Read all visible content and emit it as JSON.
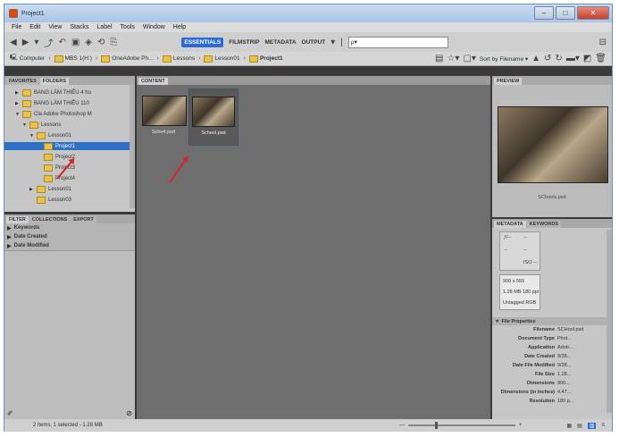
{
  "window": {
    "title": "Project1",
    "min": "–",
    "max": "□",
    "close": "✕"
  },
  "menu": [
    "File",
    "Edit",
    "View",
    "Stacks",
    "Label",
    "Tools",
    "Window",
    "Help"
  ],
  "toolbar": {
    "workspaces": [
      "ESSENTIALS",
      "FILMSTRIP",
      "METADATA",
      "OUTPUT"
    ],
    "active_workspace": "ESSENTIALS",
    "search_placeholder": "ρ▾"
  },
  "path": {
    "crumbs": [
      "Computer",
      "MBS 1(H:)",
      "OneAdobe Ph...",
      "Lessons",
      "Lesson01",
      "Project1"
    ],
    "sort_label": "Sort by Filename ▾"
  },
  "left_panel": {
    "tabs": [
      "FAVORITES",
      "FOLDERS"
    ],
    "tree": [
      {
        "label": "BANG LÄM THIÊU 4 ho",
        "depth": 0,
        "twisty": "▶"
      },
      {
        "label": "BANG LÄM THIÊU 110",
        "depth": 0,
        "twisty": "▶"
      },
      {
        "label": "Cla Adobe Photoshop M",
        "depth": 0,
        "twisty": "▼"
      },
      {
        "label": "Lessons",
        "depth": 1,
        "twisty": "▼"
      },
      {
        "label": "Lesson01",
        "depth": 2,
        "twisty": "▼"
      },
      {
        "label": "Project1",
        "depth": 3,
        "twisty": "",
        "selected": true
      },
      {
        "label": "Project2",
        "depth": 3,
        "twisty": ""
      },
      {
        "label": "Project3",
        "depth": 3,
        "twisty": ""
      },
      {
        "label": "Project4",
        "depth": 3,
        "twisty": ""
      },
      {
        "label": "Lesson01",
        "depth": 2,
        "twisty": "▶"
      },
      {
        "label": "Lesson03",
        "depth": 2,
        "twisty": ""
      }
    ],
    "filter_tabs": [
      "FILTER",
      "COLLECTIONS",
      "EXPORT"
    ],
    "filters": [
      "Keywords",
      "Date Created",
      "Date Modified"
    ]
  },
  "content": {
    "tab": "CONTENT",
    "thumbs": [
      {
        "caption": "Sche4.psd",
        "selected": false
      },
      {
        "caption": "Scheol.psd",
        "selected": true
      }
    ]
  },
  "right_panel": {
    "preview_tab": "PREVIEW",
    "preview_caption": "SChools.psd",
    "meta_tabs": [
      "METADATA",
      "KEYWORDS"
    ],
    "camera": [
      "ƒ/--",
      "--",
      "--",
      "--",
      "ISO --"
    ],
    "info": [
      "900 x 555",
      "1.28 MB  180 ppi",
      "Untagged  RGB"
    ],
    "section": "File Properties",
    "props": [
      {
        "k": "Filename",
        "v": "SCHool.psd"
      },
      {
        "k": "Document Type",
        "v": "Phot..."
      },
      {
        "k": "Application",
        "v": "Adob..."
      },
      {
        "k": "Date Created",
        "v": "9/28..."
      },
      {
        "k": "Date File Modified",
        "v": "9/28..."
      },
      {
        "k": "File Size",
        "v": "1.28..."
      },
      {
        "k": "Dimensions",
        "v": "900..."
      },
      {
        "k": "Dimensions (in inches)",
        "v": "4.47..."
      },
      {
        "k": "Resolution",
        "v": "180 p..."
      }
    ]
  },
  "status": {
    "text": "2 items, 1 selected - 1.28 MB"
  },
  "colors": {
    "accent": "#2c6bd5",
    "selection": "#2e6fc7",
    "arrow": "#d4252a"
  }
}
